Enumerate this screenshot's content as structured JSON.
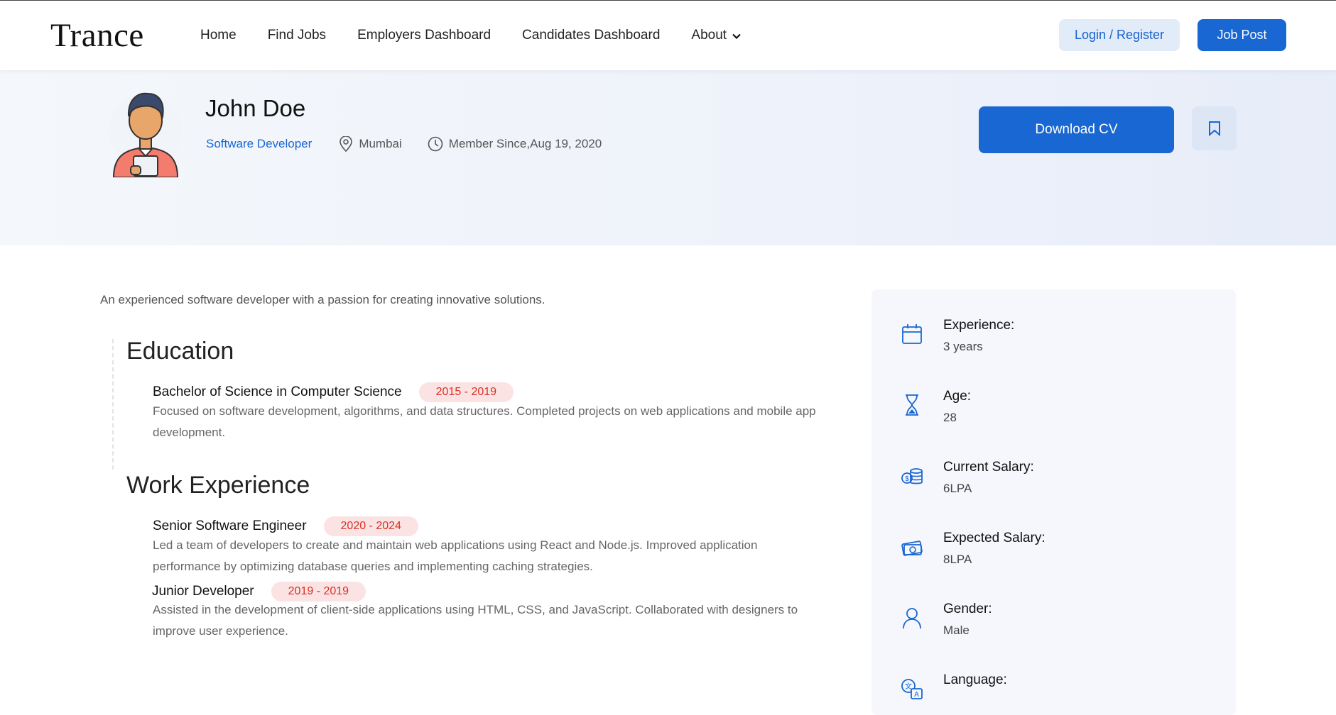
{
  "header": {
    "logo": "Trance",
    "nav": [
      {
        "label": "Home"
      },
      {
        "label": "Find Jobs"
      },
      {
        "label": "Employers Dashboard"
      },
      {
        "label": "Candidates Dashboard"
      },
      {
        "label": "About"
      }
    ],
    "login_label": "Login / Register",
    "post_label": "Job Post"
  },
  "profile": {
    "name": "John Doe",
    "role": "Software Developer",
    "location": "Mumbai",
    "member_since": "Member Since,Aug 19, 2020",
    "download_label": "Download CV"
  },
  "intro": "An experienced software developer with a passion for creating innovative solutions.",
  "education": {
    "title": "Education",
    "items": [
      {
        "title": "Bachelor of Science in Computer Science",
        "years": "2015 - 2019",
        "desc": "Focused on software development, algorithms, and data structures. Completed projects on web applications and mobile app development."
      }
    ]
  },
  "work": {
    "title": "Work Experience",
    "items": [
      {
        "title": "Senior Software Engineer",
        "years": "2020 - 2024",
        "desc": "Led a team of developers to create and maintain web applications using React and Node.js. Improved application performance by optimizing database queries and implementing caching strategies."
      },
      {
        "title": "Junior Developer",
        "years": "2019 - 2019",
        "desc": "Assisted in the development of client-side applications using HTML, CSS, and JavaScript. Collaborated with designers to improve user experience."
      }
    ]
  },
  "sidebar": {
    "items": [
      {
        "label": "Experience:",
        "value": "3 years",
        "icon": "calendar-icon"
      },
      {
        "label": "Age:",
        "value": "28",
        "icon": "hourglass-icon"
      },
      {
        "label": "Current Salary:",
        "value": "6LPA",
        "icon": "coins-icon"
      },
      {
        "label": "Expected Salary:",
        "value": "8LPA",
        "icon": "money-icon"
      },
      {
        "label": "Gender:",
        "value": "Male",
        "icon": "user-icon"
      },
      {
        "label": "Language:",
        "value": "",
        "icon": "translate-icon"
      }
    ]
  },
  "colors": {
    "accent": "#1967d2",
    "badge_bg": "#fbe3e3",
    "badge_text": "#d93025"
  }
}
